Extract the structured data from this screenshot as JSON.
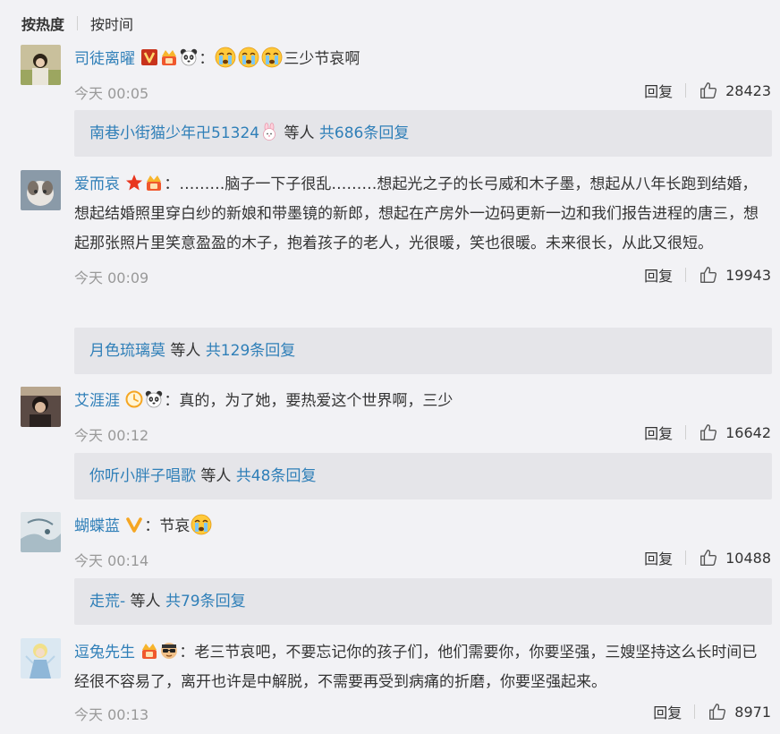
{
  "sort": {
    "hot": "按热度",
    "time": "按时间"
  },
  "labels": {
    "reply": "回复",
    "etc": " 等人 "
  },
  "comments": [
    {
      "author": "司徒离曜",
      "badges": [
        "vip-v-icon",
        "medal-icon",
        "panda-icon"
      ],
      "text_emojis": [
        "crying-emoji-icon",
        "crying-emoji-icon",
        "crying-emoji-icon"
      ],
      "text": "三少节哀啊",
      "time": "今天 00:05",
      "likes": "28423",
      "sub": {
        "name": "南巷小街猫少年卍51324",
        "total": "共686条回复"
      }
    },
    {
      "author": "爱而哀",
      "badges": [
        "star-icon",
        "medal-icon"
      ],
      "text": "………脑子一下子很乱………想起光之子的长弓威和木子墨，想起从八年长跑到结婚，想起结婚照里穿白纱的新娘和带墨镜的新郎，想起在产房外一边码更新一边和我们报告进程的唐三，想起那张照片里笑意盈盈的木子，抱着孩子的老人，光很暖，笑也很暖。未来很长，从此又很短。",
      "time": "今天 00:09",
      "likes": "19943",
      "sub": {
        "name": "月色琉璃莫",
        "total": "共129条回复"
      }
    },
    {
      "author": "艾涯涯",
      "badges": [
        "clock-icon",
        "panda-icon"
      ],
      "text": "真的，为了她，要热爱这个世界啊，三少",
      "time": "今天 00:12",
      "likes": "16642",
      "sub": {
        "name": "你听小胖子唱歌",
        "total": "共48条回复"
      }
    },
    {
      "author": "蝴蝶蓝",
      "badges": [
        "vip-v-gold-icon"
      ],
      "text": "节哀",
      "text_emojis_after": [
        "crying-emoji-icon"
      ],
      "time": "今天 00:14",
      "likes": "10488",
      "sub": {
        "name": "走荒-",
        "total": "共79条回复"
      }
    },
    {
      "author": "逗兔先生",
      "badges": [
        "medal-icon",
        "sunglasses-icon"
      ],
      "text": "老三节哀吧，不要忘记你的孩子们，他们需要你，你要坚强，三嫂坚持这么长时间已经很不容易了，离开也许是中解脱，不需要再受到病痛的折磨，你要坚强起来。",
      "time": "今天 00:13",
      "likes": "8971"
    }
  ],
  "colors": {
    "link": "#2f7fb8",
    "background": "#f2f2f5",
    "subbox": "#e5e5e9"
  }
}
